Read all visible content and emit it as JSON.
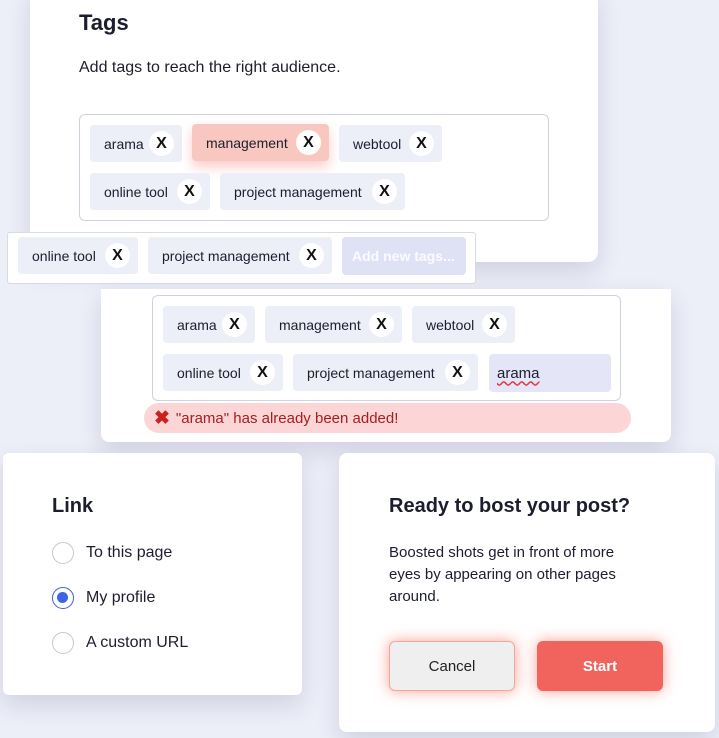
{
  "tags_card": {
    "title": "Tags",
    "description": "Add tags to reach the right audience.",
    "chips": [
      {
        "label": "arama",
        "remove": "X"
      },
      {
        "label": "management",
        "remove": "X",
        "state": "active"
      },
      {
        "label": "webtool",
        "remove": "X"
      },
      {
        "label": "online tool",
        "remove": "X"
      },
      {
        "label": "project management",
        "remove": "X"
      }
    ]
  },
  "strip": {
    "chips": [
      {
        "label": "online tool",
        "remove": "X"
      },
      {
        "label": "project management",
        "remove": "X"
      }
    ],
    "add_placeholder": "Add new tags..."
  },
  "tags_card_2": {
    "chips": [
      {
        "label": "arama",
        "remove": "X"
      },
      {
        "label": "management",
        "remove": "X"
      },
      {
        "label": "webtool",
        "remove": "X"
      },
      {
        "label": "online tool",
        "remove": "X"
      },
      {
        "label": "project management",
        "remove": "X"
      }
    ],
    "input_value": "arama",
    "error_message": "\"arama\" has already been added!"
  },
  "link_card": {
    "title": "Link",
    "options": [
      {
        "label": "To this page",
        "checked": false
      },
      {
        "label": "My profile",
        "checked": true
      },
      {
        "label": "A custom URL",
        "checked": false
      }
    ]
  },
  "boost_card": {
    "title": "Ready to bost your post?",
    "body": "Boosted shots get in front of more eyes by appearing on other pages around.",
    "cancel_label": "Cancel",
    "start_label": "Start"
  },
  "colors": {
    "accent": "#f1645e",
    "chip_bg": "#eceef8",
    "chip_active_bg": "#f8c8c0",
    "radio_checked": "#3f66e0",
    "error_bg": "#fcd6d6",
    "error_text": "#a51f1f"
  }
}
